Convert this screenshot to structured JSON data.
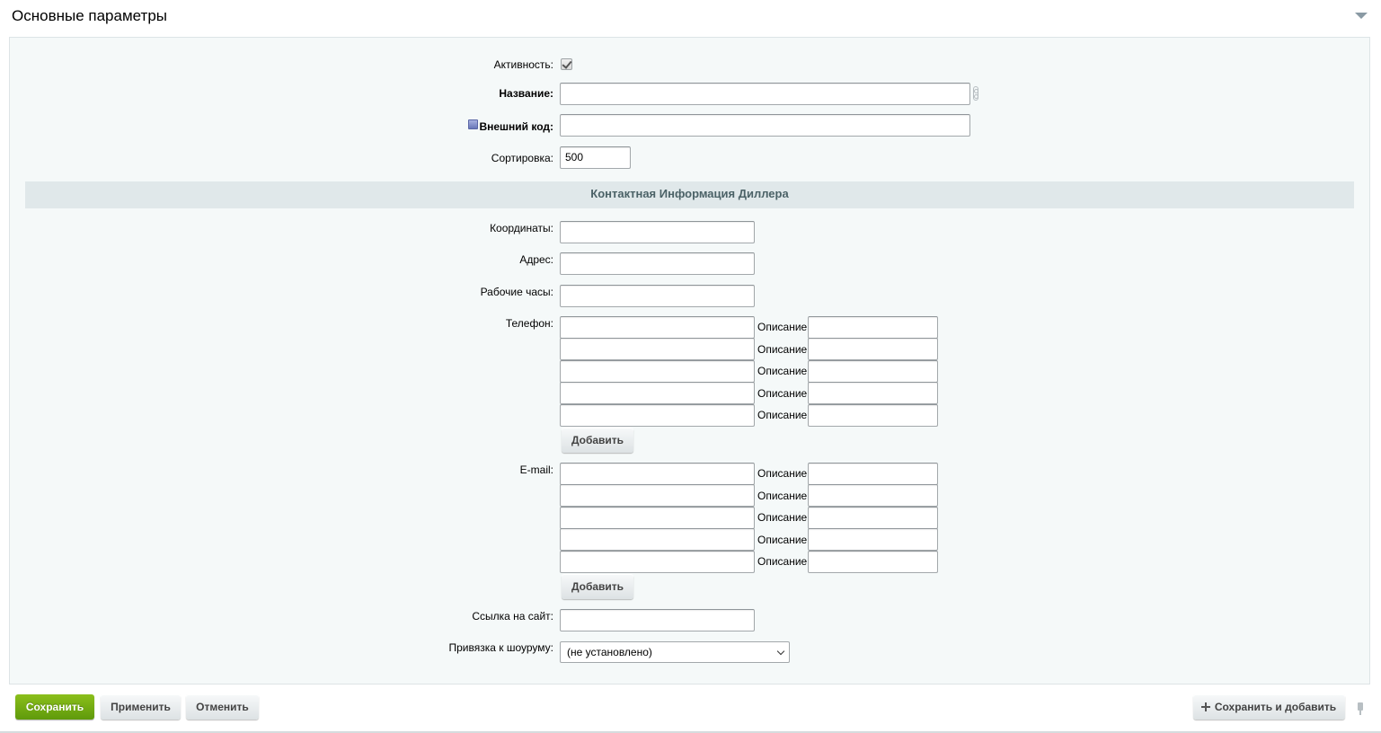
{
  "header": {
    "title": "Основные параметры"
  },
  "form": {
    "active": {
      "label": "Активность:",
      "checked": true
    },
    "name": {
      "label": "Название:",
      "value": ""
    },
    "external_code": {
      "label": "Внешний код:",
      "value": ""
    },
    "sort": {
      "label": "Сортировка:",
      "value": "500"
    },
    "section_title": "Контактная Информация Диллера",
    "coordinates": {
      "label": "Координаты:",
      "value": ""
    },
    "address": {
      "label": "Адрес:",
      "value": ""
    },
    "work_hours": {
      "label": "Рабочие часы:",
      "value": ""
    },
    "phone": {
      "label": "Телефон:",
      "desc_label": "Описание:",
      "rows": [
        "",
        "",
        "",
        "",
        ""
      ],
      "add_label": "Добавить"
    },
    "email": {
      "label": "E-mail:",
      "desc_label": "Описание:",
      "rows": [
        "",
        "",
        "",
        "",
        ""
      ],
      "add_label": "Добавить"
    },
    "site_link": {
      "label": "Ссылка на сайт:",
      "value": ""
    },
    "showroom": {
      "label": "Привязка к шоуруму:",
      "selected": "(не установлено)"
    }
  },
  "footer": {
    "save_label": "Сохранить",
    "apply_label": "Применить",
    "cancel_label": "Отменить",
    "save_add_label": "Сохранить и добавить"
  },
  "colors": {
    "accent_green": "#6fa913",
    "panel_bg": "#f5f9f9",
    "section_bg": "#e0e8ea",
    "section_text": "#4b6267"
  },
  "icons": [
    "collapse-triangle-icon",
    "checkmark-icon",
    "chain-link-icon",
    "help-icon",
    "plus-icon",
    "pin-icon",
    "chevron-down-icon"
  ]
}
